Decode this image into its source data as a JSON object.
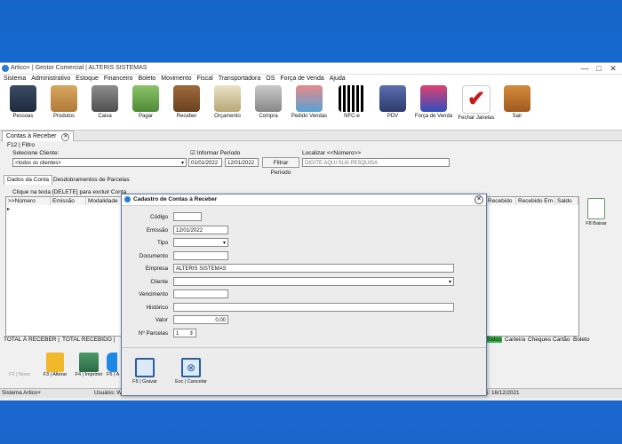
{
  "window": {
    "title": "Artico+ | Gestor Comercial | ALTERIS SISTEMAS",
    "min": "—",
    "max": "□",
    "close": "✕"
  },
  "menu": [
    "Sistema",
    "Administrativo",
    "Estoque",
    "Financeiro",
    "Boleto",
    "Movimento",
    "Fiscal",
    "Transportadora",
    "OS",
    "Força de Venda",
    "Ajuda"
  ],
  "toolbar": [
    "Pessoas",
    "Produtos",
    "Caixa",
    "Pagar",
    "Receber",
    "Orçamento",
    "Compra",
    "Pedido Vendas",
    "NFC-e",
    "PDV",
    "Força de Venda",
    "Fechar Janelas",
    "Sair"
  ],
  "tab": {
    "label": "Contas à Receber",
    "close": "✕"
  },
  "filter": {
    "header": "F12 | Filtro",
    "client_label": "Selecione Cliente:",
    "client_value": "<todos os clientes>",
    "period_check": "Informar Período",
    "date_from": "01/01/2022",
    "date_to": "12/01/2022",
    "filter_button": "Filtrar Período",
    "search_label": "Localizar <<Número>>",
    "search_placeholder": "DIGITE AQUI SUA PESQUISA"
  },
  "subtabs": {
    "account": "Dados da Conta",
    "installments": "Desdobramentos de Parcelas"
  },
  "grid": {
    "hint": "Clique na tecla [DELETE] para excluir Conta",
    "headers_left": [
      ">>Número",
      "Emissão",
      "Modalidade"
    ],
    "headers_right": [
      "Recebido",
      "Recebido Em",
      "Saldo"
    ],
    "indicator": "▸"
  },
  "side_button": {
    "label": "F8 Baixar"
  },
  "totals": {
    "to_receive": "TOTAL À RECEBER |",
    "received": "TOTAL RECEBIDO |"
  },
  "filter_tabs": [
    "Todos",
    "Carteira",
    "Cheques",
    "Cartão",
    "Boleto"
  ],
  "bottom_buttons": [
    "F2 | Novo",
    "F3 | Alterar",
    "F4 | Imprimir",
    "F5 | A"
  ],
  "status": {
    "left": "Sistema Artico+",
    "user": "Usuário: W",
    "date": "5: 16/12/2021"
  },
  "dialog": {
    "title": "Cadastro de Contas à Receber",
    "close": "✕",
    "fields": {
      "codigo": {
        "label": "Código",
        "value": ""
      },
      "emissao": {
        "label": "Emissão",
        "value": "12/01/2022"
      },
      "tipo": {
        "label": "Tipo",
        "value": ""
      },
      "documento": {
        "label": "Documento",
        "value": ""
      },
      "empresa": {
        "label": "Empresa",
        "value": "ALTERIS SISTEMAS"
      },
      "cliente": {
        "label": "Cliente",
        "value": ""
      },
      "vencimento": {
        "label": "Vencimento",
        "value": ""
      },
      "historico": {
        "label": "Histórico",
        "value": ""
      },
      "valor": {
        "label": "Valor",
        "value": "0,00"
      },
      "parcelas": {
        "label": "Nº Parcelas",
        "value": "1"
      }
    },
    "save": "F5 | Gravar",
    "cancel": "Esc | Cancelar"
  },
  "colors": {
    "desktop": "#1a6fd6",
    "accent": "#2a7bd1",
    "green": "#39b54a"
  }
}
